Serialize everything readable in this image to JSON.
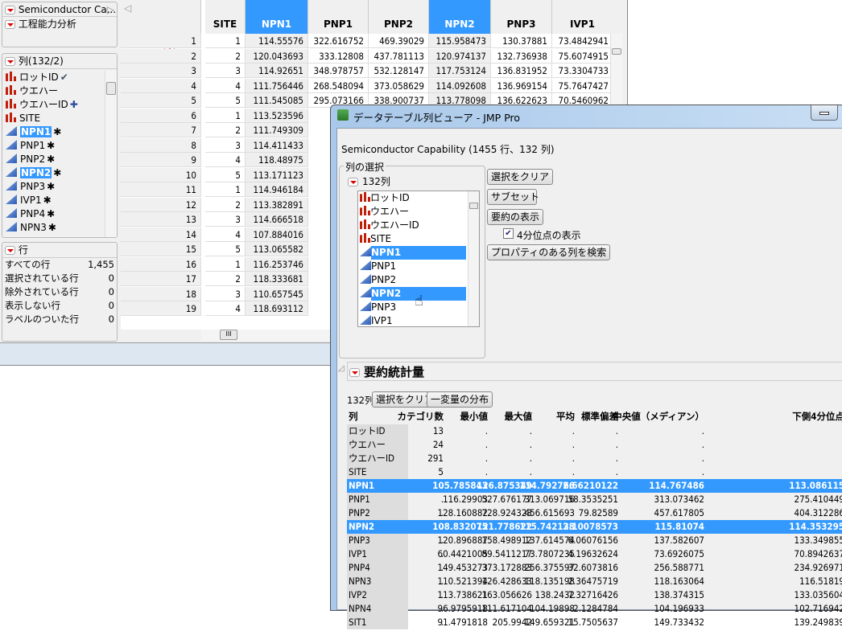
{
  "main_window": {
    "table_panel_title": "Semiconductor Ca...",
    "script_item": "工程能力分析",
    "columns_panel": {
      "title": "列(132/2)",
      "items": [
        {
          "label": "ロットID",
          "type": "nominal",
          "badge": "✔",
          "selected": false
        },
        {
          "label": "ウエハー",
          "type": "nominal",
          "badge": "",
          "selected": false
        },
        {
          "label": "ウエハーID",
          "type": "nominal",
          "badge": "✚",
          "selected": false
        },
        {
          "label": "SITE",
          "type": "nominal",
          "badge": "",
          "selected": false
        },
        {
          "label": "NPN1",
          "type": "continuous",
          "badge": "✱",
          "selected": true
        },
        {
          "label": "PNP1",
          "type": "continuous",
          "badge": "✱",
          "selected": false
        },
        {
          "label": "PNP2",
          "type": "continuous",
          "badge": "✱",
          "selected": false
        },
        {
          "label": "NPN2",
          "type": "continuous",
          "badge": "✱",
          "selected": true
        },
        {
          "label": "PNP3",
          "type": "continuous",
          "badge": "✱",
          "selected": false
        },
        {
          "label": "IVP1",
          "type": "continuous",
          "badge": "✱",
          "selected": false
        },
        {
          "label": "PNP4",
          "type": "continuous",
          "badge": "✱",
          "selected": false
        },
        {
          "label": "NPN3",
          "type": "continuous",
          "badge": "✱",
          "selected": false
        }
      ]
    },
    "rows_panel": {
      "title": "行",
      "items": [
        {
          "label": "すべての行",
          "value": "1,455"
        },
        {
          "label": "選択されている行",
          "value": "0"
        },
        {
          "label": "除外されている行",
          "value": "0"
        },
        {
          "label": "表示しない行",
          "value": "0"
        },
        {
          "label": "ラベルのついた行",
          "value": "0"
        }
      ]
    },
    "grid": {
      "headers": [
        "SITE",
        "NPN1",
        "PNP1",
        "PNP2",
        "NPN2",
        "PNP3",
        "IVP1"
      ],
      "highlighted": [
        "NPN1",
        "NPN2"
      ],
      "rows": [
        [
          "1",
          "114.55576",
          "322.616752",
          "469.39029",
          "115.958473",
          "130.37881",
          "73.4842941"
        ],
        [
          "2",
          "120.043693",
          "333.12808",
          "437.781113",
          "120.974137",
          "132.736938",
          "75.6074915"
        ],
        [
          "3",
          "114.92651",
          "348.978757",
          "532.128147",
          "117.753124",
          "136.831952",
          "73.3304733"
        ],
        [
          "4",
          "111.756446",
          "268.548094",
          "373.058629",
          "114.092608",
          "136.969154",
          "75.7647427"
        ],
        [
          "5",
          "111.545085",
          "295.073166",
          "338.900737",
          "113.778098",
          "136.622623",
          "70.5460962"
        ],
        [
          "1",
          "113.523596"
        ],
        [
          "2",
          "111.749309"
        ],
        [
          "3",
          "114.411433"
        ],
        [
          "4",
          "118.48975"
        ],
        [
          "5",
          "113.171123"
        ],
        [
          "1",
          "114.946184"
        ],
        [
          "2",
          "113.382891"
        ],
        [
          "3",
          "114.666518"
        ],
        [
          "4",
          "107.884016"
        ],
        [
          "5",
          "113.065582"
        ],
        [
          "1",
          "116.253746"
        ],
        [
          "2",
          "118.333681"
        ],
        [
          "3",
          "110.657545"
        ],
        [
          "4",
          "118.693112"
        ]
      ]
    }
  },
  "dialog": {
    "title": "データテーブル列ビューア - JMP Pro",
    "table_info": "Semiconductor Capability (1455 行、132 列)",
    "column_selection": {
      "group_label": "列の選択",
      "count_label": "132列",
      "items": [
        {
          "label": "ロットID",
          "type": "nominal",
          "selected": false
        },
        {
          "label": "ウエハー",
          "type": "nominal",
          "selected": false
        },
        {
          "label": "ウエハーID",
          "type": "nominal",
          "selected": false
        },
        {
          "label": "SITE",
          "type": "nominal",
          "selected": false
        },
        {
          "label": "NPN1",
          "type": "continuous",
          "selected": true
        },
        {
          "label": "PNP1",
          "type": "continuous",
          "selected": false
        },
        {
          "label": "PNP2",
          "type": "continuous",
          "selected": false
        },
        {
          "label": "NPN2",
          "type": "continuous",
          "selected": true
        },
        {
          "label": "PNP3",
          "type": "continuous",
          "selected": false
        },
        {
          "label": "IVP1",
          "type": "continuous",
          "selected": false
        }
      ]
    },
    "buttons": {
      "clear": "選択をクリア",
      "subset": "サブセット",
      "show_summary": "要約の表示",
      "show_quartiles": "4分位点の表示",
      "find_props": "プロパティのある列を検索"
    },
    "show_quartiles_checked": true,
    "summary": {
      "title": "要約統計量",
      "count_label": "132列",
      "clear_button": "選択をクリア",
      "distribution_button": "一変量の分布",
      "headers": [
        "列",
        "カテゴリ数",
        "最小値",
        "最大値",
        "平均",
        "標準偏差",
        "中央値（メディアン）",
        "下側4分位点"
      ],
      "rows": [
        {
          "name": "ロットID",
          "values": [
            "13",
            ".",
            ".",
            ".",
            ".",
            ".",
            "."
          ],
          "selected": false
        },
        {
          "name": "ウエハー",
          "values": [
            "24",
            ".",
            ".",
            ".",
            ".",
            ".",
            "."
          ],
          "selected": false
        },
        {
          "name": "ウエハーID",
          "values": [
            "291",
            ".",
            ".",
            ".",
            ".",
            ".",
            "."
          ],
          "selected": false
        },
        {
          "name": "SITE",
          "values": [
            "5",
            ".",
            ".",
            ".",
            ".",
            ".",
            "."
          ],
          "selected": false
        },
        {
          "name": "NPN1",
          "values": [
            ".",
            "105.785843",
            "126.875349",
            "114.792766",
            "2.66210122",
            "114.767486",
            "113.086115"
          ],
          "selected": true
        },
        {
          "name": "PNP1",
          "values": [
            ".",
            "116.29903",
            "527.676177",
            "313.069716",
            "58.3535251",
            "313.073462",
            "275.410449"
          ],
          "selected": false
        },
        {
          "name": "PNP2",
          "values": [
            ".",
            "128.160882",
            "728.924323",
            "456.615693",
            "79.82589",
            "457.617805",
            "404.312286"
          ],
          "selected": false
        },
        {
          "name": "NPN2",
          "values": [
            ".",
            "108.832075",
            "121.778622",
            "115.742138",
            "2.10078573",
            "115.81074",
            "114.353295"
          ],
          "selected": true
        },
        {
          "name": "PNP3",
          "values": [
            ".",
            "120.896887",
            "158.498912",
            "137.614574",
            "6.06076156",
            "137.582607",
            "133.349855"
          ],
          "selected": false
        },
        {
          "name": "IVP1",
          "values": [
            ".",
            "60.4421005",
            "89.5411217",
            "73.7807235",
            "4.19632624",
            "73.6926075",
            "70.8942637"
          ],
          "selected": false
        },
        {
          "name": "PNP4",
          "values": [
            ".",
            "149.453273",
            "373.172883",
            "256.375597",
            "32.6073816",
            "256.588771",
            "234.926971"
          ],
          "selected": false
        },
        {
          "name": "NPN3",
          "values": [
            ".",
            "110.521394",
            "126.428633",
            "118.135198",
            "2.36475719",
            "118.163064",
            "116.51819"
          ],
          "selected": false
        },
        {
          "name": "IVP2",
          "values": [
            ".",
            "113.738621",
            "163.056626",
            "138.2432",
            "7.32716426",
            "138.374315",
            "133.035604"
          ],
          "selected": false
        },
        {
          "name": "NPN4",
          "values": [
            ".",
            "96.9795918",
            "111.617104",
            "104.19898",
            "2.1284784",
            "104.196933",
            "102.716942"
          ],
          "selected": false
        },
        {
          "name": "SIT1",
          "values": [
            ".",
            "91.4791818",
            "205.9942",
            "149.659321",
            "15.7505637",
            "149.733432",
            "139.249839"
          ],
          "selected": false
        }
      ]
    }
  },
  "colors": {
    "selection": "#3399ff",
    "nominal_icon": "#c0200a",
    "continuous_icon": "#2a5ab8"
  }
}
